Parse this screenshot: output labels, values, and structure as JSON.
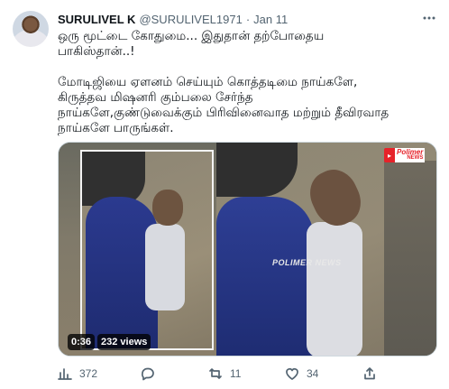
{
  "tweet": {
    "author_name": "SURULIVEL K",
    "handle": "@SURULIVEL1971",
    "separator": "·",
    "date": "Jan 11",
    "more_icon": "more-icon",
    "text_lines": [
      "ஒரு மூட்டை கோதுமை... இதுதான் தற்போதைய",
      "பாகிஸ்தான்..!",
      "",
      "மோடிஜியை ஏளனம் செய்யும் கொத்தடிமை நாய்களே,",
      "கிருத்தவ மிஷனரி கும்பலை சேர்ந்த",
      "நாய்களே,குண்டுவைக்கும் பிரிவினைவாத மற்றும் தீவிரவாத",
      "நாய்களே பாருங்கள்."
    ]
  },
  "media": {
    "duration": "0:36",
    "views_label": "232 views",
    "watermark": "POLIMER NEWS",
    "logo_text": "Polimer",
    "logo_sub": "NEWS"
  },
  "actions": {
    "views_count": "372",
    "reply_count": "",
    "retweet_count": "11",
    "like_count": "34",
    "icons": [
      "analytics-icon",
      "reply-icon",
      "retweet-icon",
      "like-icon",
      "share-icon"
    ]
  },
  "colors": {
    "text": "#0f1419",
    "secondary": "#536471",
    "border": "#cfd9de",
    "logo_red": "#e6232a"
  }
}
